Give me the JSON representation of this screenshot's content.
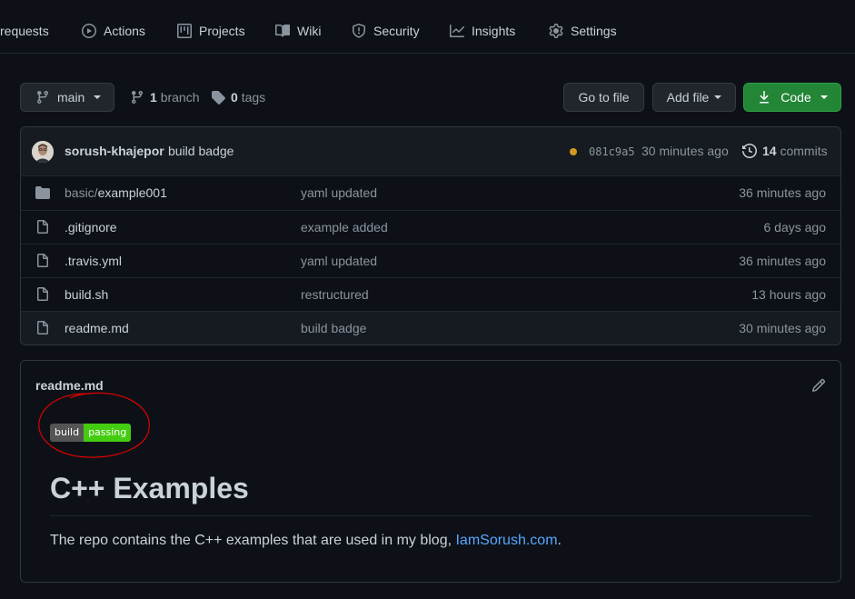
{
  "nav": {
    "tabs": [
      {
        "label": "requests",
        "icon": "pull-request-icon"
      },
      {
        "label": "Actions",
        "icon": "play-icon"
      },
      {
        "label": "Projects",
        "icon": "project-icon"
      },
      {
        "label": "Wiki",
        "icon": "book-icon"
      },
      {
        "label": "Security",
        "icon": "shield-icon"
      },
      {
        "label": "Insights",
        "icon": "graph-icon"
      },
      {
        "label": "Settings",
        "icon": "gear-icon"
      }
    ]
  },
  "toolbar": {
    "branch": "main",
    "branch_count": "1",
    "branch_label": "branch",
    "tag_count": "0",
    "tag_label": "tags",
    "go_to_file": "Go to file",
    "add_file": "Add file",
    "code": "Code"
  },
  "commit": {
    "author": "sorush-khajepor",
    "message": "build badge",
    "sha": "081c9a5",
    "time": "30 minutes ago",
    "commit_count": "14",
    "commit_label": "commits",
    "status_color": "#d29922"
  },
  "files": [
    {
      "type": "folder",
      "dir": "basic/",
      "name": "example001",
      "message": "yaml updated",
      "age": "36 minutes ago"
    },
    {
      "type": "file",
      "dir": "",
      "name": ".gitignore",
      "message": "example added",
      "age": "6 days ago"
    },
    {
      "type": "file",
      "dir": "",
      "name": ".travis.yml",
      "message": "yaml updated",
      "age": "36 minutes ago"
    },
    {
      "type": "file",
      "dir": "",
      "name": "build.sh",
      "message": "restructured",
      "age": "13 hours ago"
    },
    {
      "type": "file",
      "dir": "",
      "name": "readme.md",
      "message": "build badge",
      "age": "30 minutes ago"
    }
  ],
  "readme": {
    "filename": "readme.md",
    "badge_left": "build",
    "badge_right": "passing",
    "heading": "C++ Examples",
    "text_before": "The repo contains the C++ examples that are used in my blog, ",
    "link_text": "IamSorush.com",
    "text_after": "."
  },
  "colors": {
    "background": "#0d1117",
    "accent_green": "#238636",
    "link": "#58a6ff",
    "annotation": "#ff0000"
  }
}
